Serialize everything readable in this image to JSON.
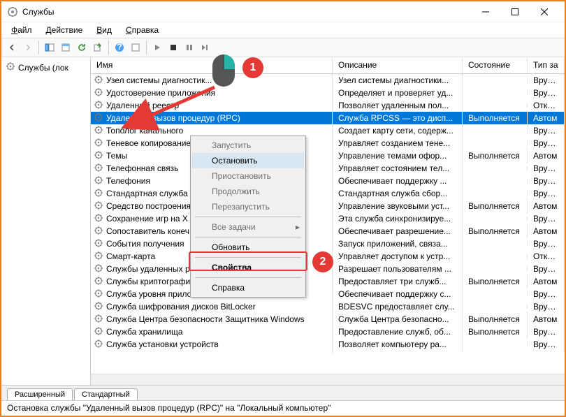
{
  "titlebar": {
    "text": "Службы"
  },
  "menu": {
    "file": "Файл",
    "action": "Действие",
    "view": "Вид",
    "help": "Справка"
  },
  "sidebar": {
    "label": "Службы (лок"
  },
  "columns": {
    "name": "Имя",
    "desc": "Описание",
    "state": "Состояние",
    "type": "Тип за"
  },
  "rows": [
    {
      "name": "Узел системы диагностик...",
      "desc": "Узел системы диагностики...",
      "state": "",
      "type": "Вручну"
    },
    {
      "name": "Удостоверение приложения",
      "desc": "Определяет и проверяет уд...",
      "state": "",
      "type": "Вручну"
    },
    {
      "name": "Удаленный реестр",
      "desc": "Позволяет удаленным пол...",
      "state": "",
      "type": "Отклю"
    },
    {
      "name": "Удаленный вызов процедур (RPC)",
      "desc": "Служба RPCSS — это дисп...",
      "state": "Выполняется",
      "type": "Автом",
      "selected": true
    },
    {
      "name": "Тополог канального",
      "desc": "Создает карту сети, содерж...",
      "state": "",
      "type": "Вручну"
    },
    {
      "name": "Теневое копирование",
      "desc": "Управляет созданием тене...",
      "state": "",
      "type": "Вручну"
    },
    {
      "name": "Темы",
      "desc": "Управление темами офор...",
      "state": "Выполняется",
      "type": "Автом"
    },
    {
      "name": "Телефонная связь",
      "desc": "Управляет состоянием тел...",
      "state": "",
      "type": "Вручну"
    },
    {
      "name": "Телефония",
      "desc": "Обеспечивает поддержку ...",
      "state": "",
      "type": "Вручну"
    },
    {
      "name": "Стандартная служба сборщика Microsoft ...",
      "desc": "Стандартная служба сбор...",
      "state": "",
      "type": "Вручну"
    },
    {
      "name": "Средство построения",
      "desc": "Управление звуковыми уст...",
      "state": "Выполняется",
      "type": "Автом"
    },
    {
      "name": "Сохранение игр на X",
      "desc": "Эта служба синхронизируе...",
      "state": "",
      "type": "Вручну"
    },
    {
      "name": "Сопоставитель конеч",
      "desc": "Обеспечивает разрешение...",
      "state": "Выполняется",
      "type": "Автом"
    },
    {
      "name": "События получения",
      "desc": "Запуск приложений, связа...",
      "state": "",
      "type": "Вручну"
    },
    {
      "name": "Смарт-карта",
      "desc": "Управляет доступом к устр...",
      "state": "",
      "type": "Отклю"
    },
    {
      "name": "Службы удаленных ра...",
      "desc": "Разрешает пользователям ...",
      "state": "",
      "type": "Вручну"
    },
    {
      "name": "Службы криптографии",
      "desc": "Предоставляет три служб...",
      "state": "Выполняется",
      "type": "Автом"
    },
    {
      "name": "Служба уровня приложения",
      "desc": "Обеспечивает поддержку с...",
      "state": "",
      "type": "Вручну"
    },
    {
      "name": "Служба шифрования дисков BitLocker",
      "desc": "BDESVC предоставляет слу...",
      "state": "",
      "type": "Вручну"
    },
    {
      "name": "Служба Центра безопасности Защитника Windows",
      "desc": "Служба Центра безопасно...",
      "state": "Выполняется",
      "type": "Автом"
    },
    {
      "name": "Служба хранилища",
      "desc": "Предоставление служб, об...",
      "state": "Выполняется",
      "type": "Вручну"
    },
    {
      "name": "Служба установки устройств",
      "desc": "Позволяет компьютеру ра...",
      "state": "",
      "type": "Вручну"
    }
  ],
  "context_menu": {
    "start": "Запустить",
    "stop": "Остановить",
    "pause": "Приостановить",
    "resume": "Продолжить",
    "restart": "Перезапустить",
    "all_tasks": "Все задачи",
    "refresh": "Обновить",
    "properties": "Свойства",
    "help": "Справка"
  },
  "tabs": {
    "extended": "Расширенный",
    "standard": "Стандартный"
  },
  "statusbar": {
    "text": "Остановка службы \"Удаленный вызов процедур (RPC)\" на \"Локальный компьютер\""
  },
  "badges": {
    "one": "1",
    "two": "2"
  }
}
